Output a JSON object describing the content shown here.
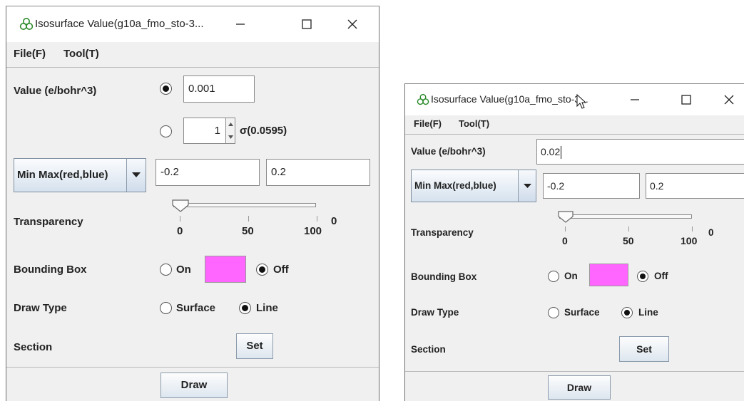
{
  "window_left": {
    "title": "Isosurface Value(g10a_fmo_sto-3...",
    "menu": {
      "file": "File(F)",
      "tool": "Tool(T)"
    },
    "value_label": "Value (e/bohr^3)",
    "value_input": "0.001",
    "sigma_spinner": "1",
    "sigma_label": "σ(0.0595)",
    "range_mode": "Min Max(red,blue)",
    "min_value": "-0.2",
    "max_value": "0.2",
    "transparency_label": "Transparency",
    "transparency_value": "0",
    "transparency_ticks": [
      "0",
      "50",
      "100"
    ],
    "bounding_box_label": "Bounding Box",
    "bb_on": "On",
    "bb_off": "Off",
    "draw_type_label": "Draw Type",
    "draw_surface": "Surface",
    "draw_line": "Line",
    "section_label": "Section",
    "set_button": "Set",
    "draw_button": "Draw"
  },
  "window_right": {
    "title": "Isosurface Value(g10a_fmo_sto-3...",
    "menu": {
      "file": "File(F)",
      "tool": "Tool(T)"
    },
    "value_label": "Value (e/bohr^3)",
    "value_input": "0.02",
    "range_mode": "Min Max(red,blue)",
    "min_value": "-0.2",
    "max_value": "0.2",
    "transparency_label": "Transparency",
    "transparency_value": "0",
    "transparency_ticks": [
      "0",
      "50",
      "100"
    ],
    "bounding_box_label": "Bounding Box",
    "bb_on": "On",
    "bb_off": "Off",
    "draw_type_label": "Draw Type",
    "draw_surface": "Surface",
    "draw_line": "Line",
    "section_label": "Section",
    "set_button": "Set",
    "draw_button": "Draw"
  },
  "colors": {
    "bounding_box_color": "#ff66ff",
    "window_bg": "#f0f0f0",
    "titlebar_bg": "#ffffff"
  }
}
